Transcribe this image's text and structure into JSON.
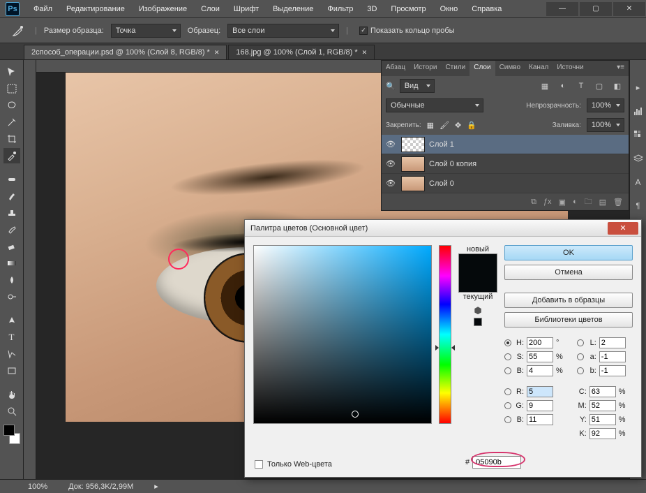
{
  "app": {
    "logo": "Ps"
  },
  "menu": [
    "Файл",
    "Редактирование",
    "Изображение",
    "Слои",
    "Шрифт",
    "Выделение",
    "Фильтр",
    "3D",
    "Просмотр",
    "Окно",
    "Справка"
  ],
  "options": {
    "sample_size_label": "Размер образца:",
    "sample_size_value": "Точка",
    "sample_label": "Образец:",
    "sample_value": "Все слои",
    "show_ring": "Показать кольцо пробы",
    "show_ring_checked": true
  },
  "tabs": [
    {
      "label": "2способ_операции.psd @ 100% (Слой 8, RGB/8) *",
      "active": false
    },
    {
      "label": "168.jpg @ 100% (Слой 1, RGB/8) *",
      "active": true
    }
  ],
  "status": {
    "zoom": "100%",
    "doc": "Док: 956,3K/2,99M"
  },
  "panel": {
    "tabs": [
      "Абзац",
      "Истори",
      "Стили",
      "Слои",
      "Симво",
      "Канал",
      "Источни"
    ],
    "active_tab": "Слои",
    "kind_label": "Вид",
    "blend_mode": "Обычные",
    "opacity_label": "Непрозрачность:",
    "opacity_value": "100%",
    "lock_label": "Закрепить:",
    "fill_label": "Заливка:",
    "fill_value": "100%",
    "layers": [
      {
        "name": "Слой 1",
        "selected": true,
        "thumb": "checker"
      },
      {
        "name": "Слой 0 копия",
        "selected": false,
        "thumb": "eye"
      },
      {
        "name": "Слой 0",
        "selected": false,
        "thumb": "eye"
      }
    ]
  },
  "dialog": {
    "title": "Палитра цветов (Основной цвет)",
    "new_label": "новый",
    "current_label": "текущий",
    "ok": "OK",
    "cancel": "Отмена",
    "add_swatch": "Добавить в образцы",
    "libraries": "Библиотеки цветов",
    "web_only": "Только Web-цвета",
    "hex_label": "#",
    "hex_value": "05090b",
    "hsb": {
      "H": "200",
      "S": "55",
      "B": "4"
    },
    "rgb": {
      "R": "5",
      "G": "9",
      "B": "11"
    },
    "lab": {
      "L": "2",
      "a": "-1",
      "b": "-1"
    },
    "cmyk": {
      "C": "63",
      "M": "52",
      "Y": "51",
      "K": "92"
    },
    "units": {
      "deg": "°",
      "pct": "%"
    },
    "new_color": "#05090b",
    "current_color": "#05090b"
  }
}
